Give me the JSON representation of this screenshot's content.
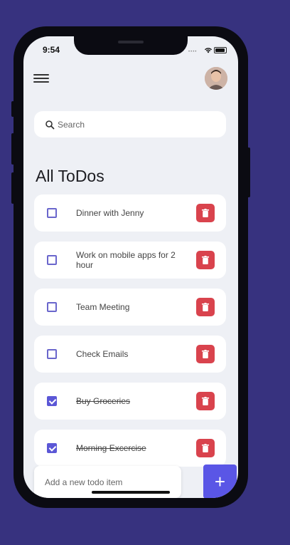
{
  "status_bar": {
    "time": "9:54"
  },
  "header": {
    "menu_icon": "hamburger-menu-icon",
    "avatar_icon": "user-avatar"
  },
  "search": {
    "placeholder": "Search",
    "icon": "search-icon"
  },
  "page_title": "All ToDos",
  "todos": [
    {
      "text": "Dinner with Jenny",
      "done": false
    },
    {
      "text": "Work on mobile apps for 2 hour",
      "done": false
    },
    {
      "text": "Team Meeting",
      "done": false
    },
    {
      "text": "Check Emails",
      "done": false
    },
    {
      "text": "Buy Groceries",
      "done": true
    },
    {
      "text": "Morning Excercise",
      "done": true
    }
  ],
  "add_item": {
    "placeholder": "Add a new todo item",
    "button_label": "+"
  },
  "colors": {
    "background": "#37327f",
    "accent": "#5a56e6",
    "delete": "#d9434d",
    "screen": "#eef0f5"
  }
}
